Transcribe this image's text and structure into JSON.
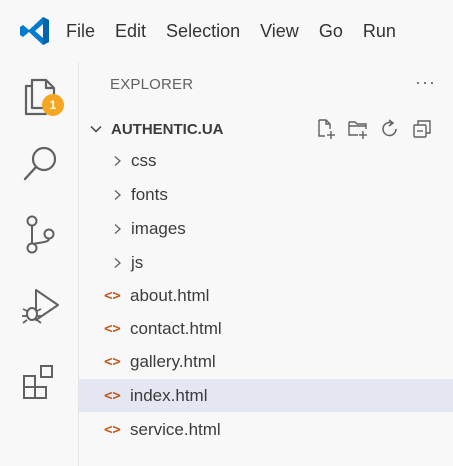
{
  "menubar": {
    "items": [
      "File",
      "Edit",
      "Selection",
      "View",
      "Go",
      "Run"
    ]
  },
  "activitybar": {
    "explorer_badge": "1",
    "icons": [
      "files-icon",
      "search-icon",
      "source-control-icon",
      "run-debug-icon",
      "extensions-icon"
    ]
  },
  "sidebar": {
    "header": "EXPLORER",
    "more": "···",
    "folder": {
      "name": "AUTHENTIC.UA"
    },
    "items": [
      {
        "label": "css",
        "type": "folder"
      },
      {
        "label": "fonts",
        "type": "folder"
      },
      {
        "label": "images",
        "type": "folder"
      },
      {
        "label": "js",
        "type": "folder"
      },
      {
        "label": "about.html",
        "type": "file"
      },
      {
        "label": "contact.html",
        "type": "file"
      },
      {
        "label": "gallery.html",
        "type": "file"
      },
      {
        "label": "index.html",
        "type": "file",
        "selected": true
      },
      {
        "label": "service.html",
        "type": "file"
      }
    ],
    "file_icon_glyph": "<>"
  },
  "colors": {
    "logo_blue": "#007acc",
    "badge": "#f5a623",
    "html_icon": "#c2581a",
    "selected_row": "#e4e6f1"
  }
}
